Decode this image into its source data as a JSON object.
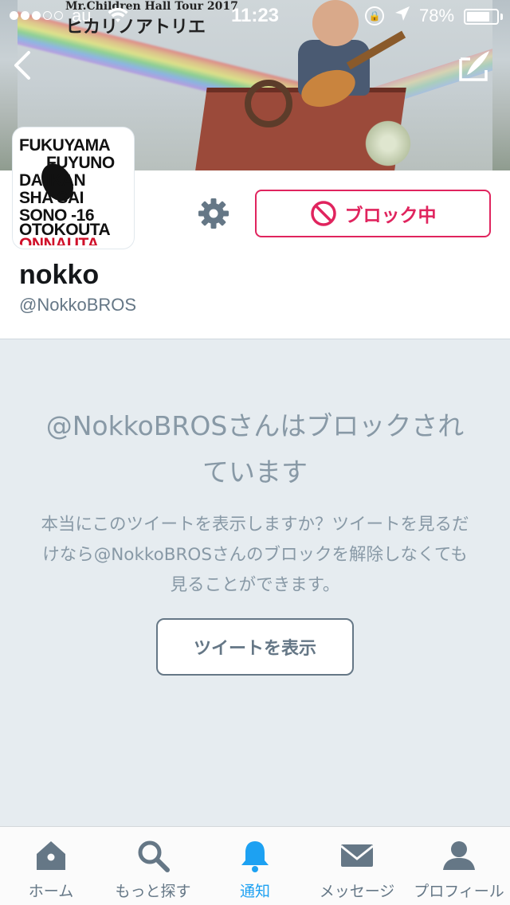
{
  "status_bar": {
    "carrier": "au",
    "time": "11:23",
    "battery": "78%",
    "battery_level": 0.78
  },
  "banner": {
    "poster_line1": "Mr.Children Hall Tour 2017",
    "poster_line2": "ヒカリノアトリエ"
  },
  "avatar": {
    "lines": [
      "FUKUYAMA",
      "FUYUNO",
      "DA  IKAN",
      "SHA  SAI",
      "SONO  -16",
      "OTOKOUTA",
      "ONNAUTA"
    ]
  },
  "profile": {
    "name": "nokko",
    "handle": "@NokkoBROS",
    "block_button_label": "ブロック中"
  },
  "blocked": {
    "title": "@NokkoBROSさんはブロックされています",
    "description": "本当にこのツイートを表示しますか？ツイートを見るだけなら@NokkoBROSさんのブロックを解除しなくても見ることができます。",
    "show_button": "ツイートを表示"
  },
  "tabbar": {
    "items": [
      {
        "label": "ホーム",
        "icon": "home-icon"
      },
      {
        "label": "もっと探す",
        "icon": "search-icon"
      },
      {
        "label": "通知",
        "icon": "bell-icon",
        "active": true
      },
      {
        "label": "メッセージ",
        "icon": "envelope-icon"
      },
      {
        "label": "プロフィール",
        "icon": "person-icon"
      }
    ]
  },
  "colors": {
    "accent": "#1da1f2",
    "block_red": "#e0245e",
    "muted": "#657786",
    "background": "#e6ecf0"
  }
}
